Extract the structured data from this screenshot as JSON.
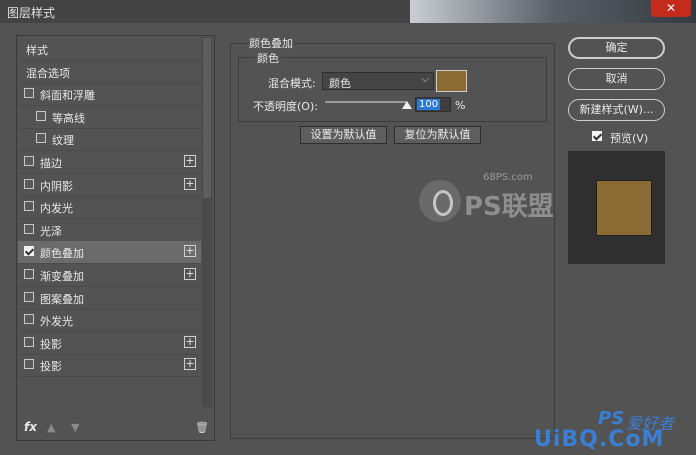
{
  "window": {
    "title": "图层样式",
    "close_label": "✕"
  },
  "left_panel": {
    "items": [
      {
        "label": "样式",
        "checkbox": false,
        "checked": false,
        "plus": false,
        "indent": 0,
        "selected": false
      },
      {
        "label": "混合选项",
        "checkbox": false,
        "checked": false,
        "plus": false,
        "indent": 0,
        "selected": false
      },
      {
        "label": "斜面和浮雕",
        "checkbox": true,
        "checked": false,
        "plus": false,
        "indent": 0,
        "selected": false
      },
      {
        "label": "等高线",
        "checkbox": true,
        "checked": false,
        "plus": false,
        "indent": 1,
        "selected": false
      },
      {
        "label": "纹理",
        "checkbox": true,
        "checked": false,
        "plus": false,
        "indent": 1,
        "selected": false
      },
      {
        "label": "描边",
        "checkbox": true,
        "checked": false,
        "plus": true,
        "indent": 0,
        "selected": false
      },
      {
        "label": "内阴影",
        "checkbox": true,
        "checked": false,
        "plus": true,
        "indent": 0,
        "selected": false
      },
      {
        "label": "内发光",
        "checkbox": true,
        "checked": false,
        "plus": false,
        "indent": 0,
        "selected": false
      },
      {
        "label": "光泽",
        "checkbox": true,
        "checked": false,
        "plus": false,
        "indent": 0,
        "selected": false
      },
      {
        "label": "颜色叠加",
        "checkbox": true,
        "checked": true,
        "plus": true,
        "indent": 0,
        "selected": true
      },
      {
        "label": "渐变叠加",
        "checkbox": true,
        "checked": false,
        "plus": true,
        "indent": 0,
        "selected": false
      },
      {
        "label": "图案叠加",
        "checkbox": true,
        "checked": false,
        "plus": false,
        "indent": 0,
        "selected": false
      },
      {
        "label": "外发光",
        "checkbox": true,
        "checked": false,
        "plus": false,
        "indent": 0,
        "selected": false
      },
      {
        "label": "投影",
        "checkbox": true,
        "checked": false,
        "plus": true,
        "indent": 0,
        "selected": false
      },
      {
        "label": "投影",
        "checkbox": true,
        "checked": false,
        "plus": true,
        "indent": 0,
        "selected": false
      }
    ],
    "fx_label": "fx",
    "up_icon": "▲",
    "down_icon": "▼",
    "trash_icon": "🗑"
  },
  "main": {
    "section_title": "颜色叠加",
    "group_title": "颜色",
    "blend_mode_label": "混合模式:",
    "blend_mode_value": "颜色",
    "chevron": "⌵",
    "overlay_color": "#8c6a34",
    "opacity_label": "不透明度(O):",
    "opacity_value": "100",
    "opacity_fraction": 1.0,
    "opacity_unit": "%",
    "set_default_label": "设置为默认值",
    "reset_default_label": "复位为默认值"
  },
  "right": {
    "ok_label": "确定",
    "cancel_label": "取消",
    "new_style_label": "新建样式(W)...",
    "preview_label": "预览(V)",
    "preview_checked": true,
    "preview_bg": "#2f2f2f",
    "preview_swatch": "#8c6a34"
  },
  "watermarks": {
    "site": "68PS.com",
    "ps_brand": "PS联盟",
    "bottom_brand": "UiBQ.CoM",
    "bottom_ps": "PS",
    "bottom_cn": "爱好者"
  }
}
